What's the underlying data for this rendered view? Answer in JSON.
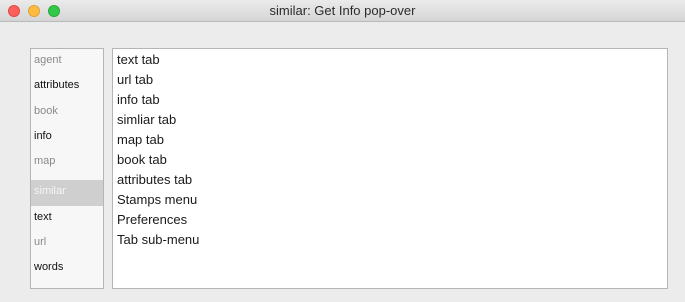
{
  "window": {
    "title": "similar: Get Info pop-over"
  },
  "traffic_lights": [
    "close",
    "minimize",
    "zoom"
  ],
  "sidebar": {
    "selected": "similar",
    "items": [
      {
        "label": "agent",
        "style": "gray"
      },
      {
        "label": "attributes",
        "style": "bold"
      },
      {
        "label": "book",
        "style": "gray"
      },
      {
        "label": "info",
        "style": "bold"
      },
      {
        "label": "map",
        "style": "gray"
      },
      {
        "label": "similar",
        "style": "selected"
      },
      {
        "label": "text",
        "style": "bold"
      },
      {
        "label": "url",
        "style": "gray"
      },
      {
        "label": "words",
        "style": "bold"
      }
    ]
  },
  "content": {
    "items": [
      "text tab",
      "url tab",
      "info tab",
      "simliar tab",
      "map tab",
      "book tab",
      "attributes tab",
      "Stamps menu",
      "Preferences",
      "Tab sub-menu"
    ]
  },
  "colors": {
    "close": "#fc605c",
    "minimize": "#fdbc40",
    "zoom": "#34c84a",
    "selected_row": "#cfcfcf"
  }
}
